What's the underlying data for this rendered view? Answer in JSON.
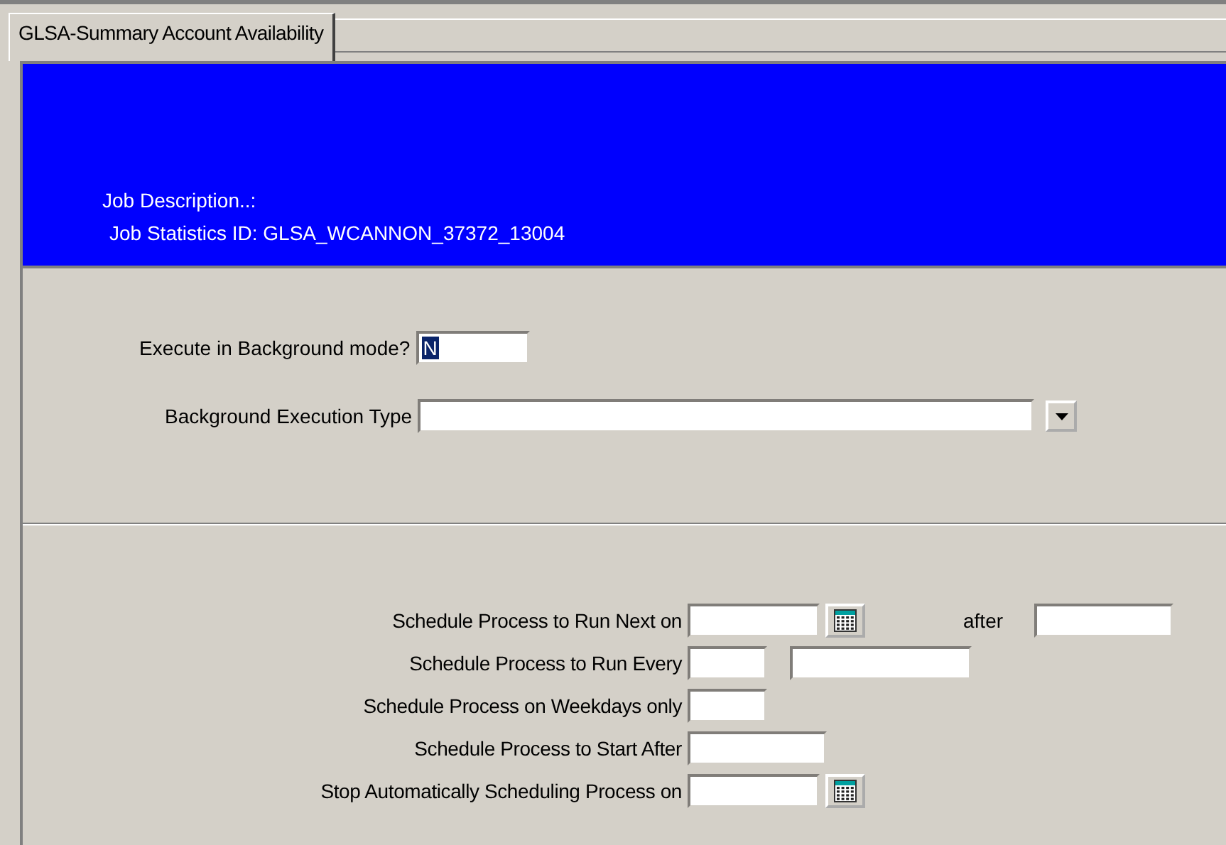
{
  "tabs": [
    {
      "label": "GLSA-Summary Account Availability",
      "selected": true
    }
  ],
  "header": {
    "job_description": "Job Description..:",
    "job_statistics_id": "Job Statistics ID:  GLSA_WCANNON_37372_13004"
  },
  "background": {
    "execute_label": "Execute in Background mode?",
    "execute_value": "N",
    "execute_value_selected": true,
    "type_label": "Background Execution Type"
  },
  "schedule": [
    {
      "label": "Schedule Process to Run Next on",
      "fields": [
        {
          "kind": "date"
        },
        {
          "kind": "caption",
          "text": "after"
        },
        {
          "kind": "medium"
        }
      ]
    },
    {
      "label": "Schedule Process to Run Every",
      "fields": [
        {
          "kind": "short"
        },
        {
          "kind": "long"
        }
      ]
    },
    {
      "label": "Schedule Process on Weekdays only",
      "fields": [
        {
          "kind": "short"
        }
      ]
    },
    {
      "label": "Schedule Process to Start After",
      "fields": [
        {
          "kind": "medium"
        }
      ]
    },
    {
      "label": "Stop Automatically Scheduling Process on",
      "fields": [
        {
          "kind": "date"
        }
      ]
    }
  ]
}
